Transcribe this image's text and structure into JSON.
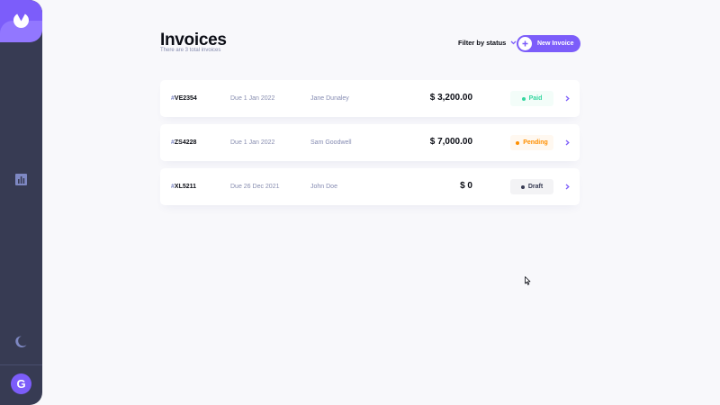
{
  "sidebar": {
    "logo_icon": "logo-icon",
    "nav_icon": "chart-icon",
    "theme_toggle_icon": "moon-icon",
    "avatar_initial": "G"
  },
  "header": {
    "title": "Invoices",
    "subtitle": "There are 3 total invoices",
    "filter_label": "Filter by status",
    "new_invoice_label": "New Invoice"
  },
  "invoices": [
    {
      "hash": "#",
      "id": "VE2354",
      "due": "Due 1 Jan 2022",
      "client": "Jane Dunaley",
      "amount": "$ 3,200.00",
      "status": "Paid"
    },
    {
      "hash": "#",
      "id": "ZS4228",
      "due": "Due 1 Jan 2022",
      "client": "Sam Goodwell",
      "amount": "$ 7,000.00",
      "status": "Pending"
    },
    {
      "hash": "#",
      "id": "XL5211",
      "due": "Due 26 Dec 2021",
      "client": "John Doe",
      "amount": "$ 0",
      "status": "Draft"
    }
  ],
  "colors": {
    "accent": "#7c5dfa",
    "sidebar": "#373b53",
    "background": "#f8f8fb",
    "paid": "#33d69f",
    "pending": "#ff8f00",
    "draft": "#373b53"
  }
}
